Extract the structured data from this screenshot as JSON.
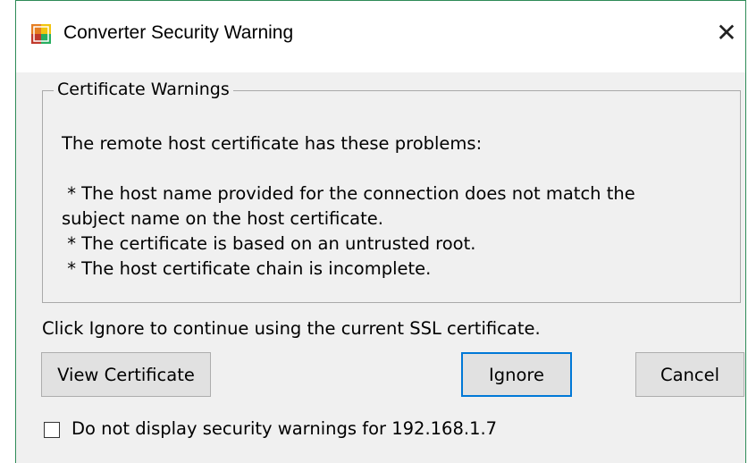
{
  "window": {
    "title": "Converter Security Warning",
    "close_glyph": "✕"
  },
  "group": {
    "legend": "Certificate Warnings",
    "lines": [
      "The remote host certificate has these problems:",
      " * The host name provided for the connection does not match the",
      "subject name on the host certificate.",
      " * The certificate is based on an untrusted root.",
      " * The host certificate chain is incomplete."
    ]
  },
  "info_text": "Click Ignore to continue using the current SSL certificate.",
  "buttons": {
    "view_certificate": "View Certificate",
    "ignore": "Ignore",
    "cancel": "Cancel"
  },
  "checkbox": {
    "label": "Do not display security warnings for 192.168.1.7",
    "checked": false
  },
  "colors": {
    "dialog_bg": "#f0f0f0",
    "accent_border": "#0078d7",
    "window_border": "#2e8b57"
  },
  "icons": {
    "app": "converter-app-icon",
    "close": "close-icon"
  }
}
